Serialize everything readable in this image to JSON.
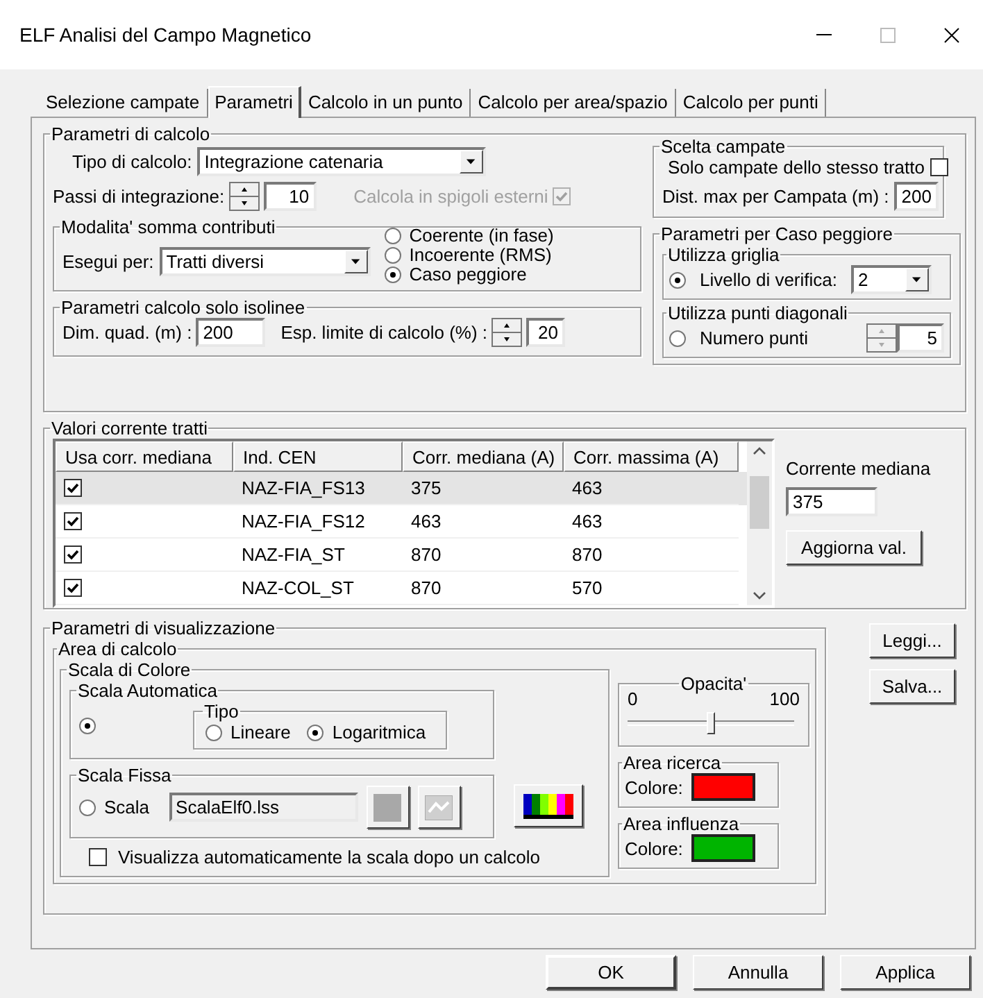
{
  "window": {
    "title": "ELF Analisi del Campo Magnetico"
  },
  "tabs": [
    {
      "label": "Selezione campate",
      "selected": false
    },
    {
      "label": "Parametri",
      "selected": true
    },
    {
      "label": "Calcolo in un punto",
      "selected": false
    },
    {
      "label": "Calcolo per area/spazio",
      "selected": false
    },
    {
      "label": "Calcolo per punti",
      "selected": false
    }
  ],
  "calc": {
    "title": "Parametri di calcolo",
    "tipo": {
      "label": "Tipo di calcolo:",
      "value": "Integrazione catenaria"
    },
    "passi": {
      "label": "Passi di integrazione:",
      "value": "10"
    },
    "spigoli": {
      "label": "Calcola in spigoli esterni",
      "checked": true,
      "disabled": true
    },
    "modalita": {
      "title": "Modalita' somma contributi",
      "label": "Esegui per:",
      "value": "Tratti diversi",
      "options": [
        {
          "label": "Coerente (in fase)",
          "selected": false
        },
        {
          "label": "Incoerente (RMS)",
          "selected": false
        },
        {
          "label": "Caso peggiore",
          "selected": true
        }
      ]
    },
    "isolinee": {
      "title": "Parametri calcolo solo isolinee",
      "dim_label": "Dim. quad. (m) :",
      "dim_value": "200",
      "esp_label": "Esp. limite di calcolo (%) :",
      "esp_value": "20"
    },
    "scelta": {
      "title": "Scelta campate",
      "solo_label": "Solo campate dello stesso tratto",
      "solo_checked": false,
      "dist_label": "Dist. max per Campata (m) :",
      "dist_value": "200"
    },
    "peggiore": {
      "title": "Parametri per Caso peggiore",
      "modes": [
        {
          "kind": "combo",
          "title": "Utilizza griglia",
          "selected": true,
          "label": "Livello di verifica:",
          "value": "2"
        },
        {
          "kind": "spin",
          "title": "Utilizza punti diagonali",
          "selected": false,
          "label": "Numero punti",
          "value": "5"
        }
      ]
    }
  },
  "currents": {
    "title": "Valori corrente tratti",
    "columns": [
      "Usa corr. mediana",
      "Ind. CEN",
      "Corr. mediana (A)",
      "Corr. massima (A)"
    ],
    "rows": [
      {
        "checked": true,
        "selected": true,
        "cells": [
          "",
          "NAZ-FIA_FS13",
          "375",
          "463"
        ]
      },
      {
        "checked": true,
        "selected": false,
        "cells": [
          "",
          "NAZ-FIA_FS12",
          "463",
          "463"
        ]
      },
      {
        "checked": true,
        "selected": false,
        "cells": [
          "",
          "NAZ-FIA_ST",
          "870",
          "870"
        ]
      },
      {
        "checked": true,
        "selected": false,
        "cells": [
          "",
          "NAZ-COL_ST",
          "870",
          "570"
        ]
      }
    ],
    "side_label": "Corrente mediana",
    "side_value": "375",
    "update": "Aggiorna val."
  },
  "display": {
    "title": "Parametri di visualizzazione",
    "area": "Area di calcolo",
    "scale": "Scala di Colore",
    "auto": {
      "title": "Scala Automatica",
      "selected": true,
      "type_title": "Tipo",
      "types": [
        {
          "label": "Lineare",
          "selected": false
        },
        {
          "label": "Logaritmica",
          "selected": true
        }
      ]
    },
    "fixed": {
      "title": "Scala Fissa",
      "selected": false,
      "label": "Scala",
      "file": "ScalaElf0.lss"
    },
    "autoshow": {
      "label": "Visualizza automaticamente la scala dopo un calcolo",
      "checked": false
    },
    "opacity": {
      "title": "Opacita'",
      "min": "0",
      "max": "100",
      "level": 0.5
    },
    "areas": [
      {
        "title": "Area ricerca",
        "label": "Colore:",
        "color": "#ff0000"
      },
      {
        "title": "Area influenza",
        "label": "Colore:",
        "color": "#00b400"
      }
    ]
  },
  "side_buttons": [
    "Leggi...",
    "Salva..."
  ],
  "buttons": [
    "OK",
    "Annulla",
    "Applica"
  ]
}
